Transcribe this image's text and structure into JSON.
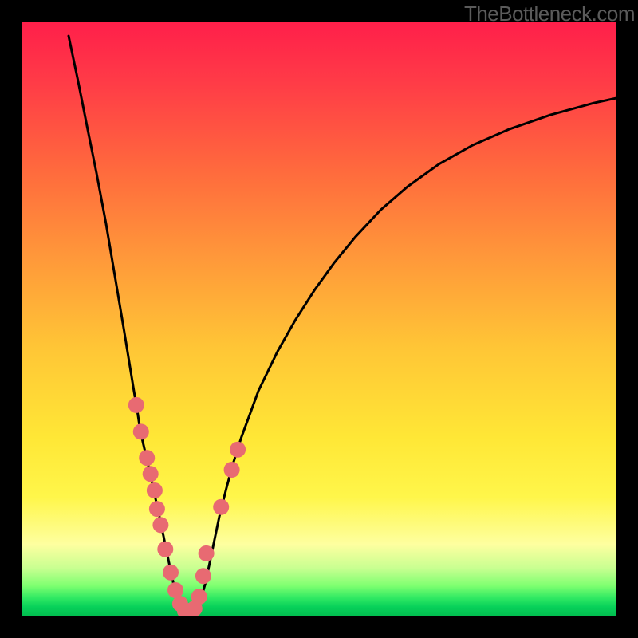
{
  "watermark": "TheBottleneck.com",
  "colors": {
    "curve": "#000000",
    "dots": "#e86a72",
    "frame": "#000000"
  },
  "chart_data": {
    "type": "line",
    "title": "",
    "xlabel": "",
    "ylabel": "",
    "xlim": [
      0,
      100
    ],
    "ylim": [
      0,
      100
    ],
    "note": "Axes are implicit (no ticks shown). x spans plot width, y spans plot height (0 at bottom, 100 at top). Values approximated from pixel positions on a 744x744 plot inside an 800x800 frame.",
    "series": [
      {
        "name": "left_branch",
        "x": [
          7.8,
          9.4,
          10.9,
          12.5,
          14.1,
          15.6,
          17.2,
          18.8,
          19.4,
          19.9,
          20.7,
          21.5,
          22.3,
          23.1,
          23.9,
          24.7,
          25.5,
          26.3,
          27.1
        ],
        "y": [
          97.7,
          90.1,
          82.5,
          74.6,
          66.1,
          57.2,
          47.7,
          37.9,
          34.4,
          31.0,
          27.6,
          24.1,
          20.4,
          16.7,
          12.9,
          9.0,
          5.3,
          2.5,
          1.0
        ]
      },
      {
        "name": "valley_floor",
        "x": [
          27.1,
          27.8,
          28.5,
          29.2
        ],
        "y": [
          1.0,
          0.6,
          0.6,
          1.0
        ]
      },
      {
        "name": "right_branch",
        "x": [
          29.2,
          30.0,
          30.8,
          31.6,
          32.4,
          33.2,
          34.4,
          35.6,
          36.9,
          39.8,
          43.0,
          46.0,
          49.2,
          52.5,
          56.1,
          60.4,
          64.9,
          70.2,
          75.9,
          82.1,
          89.0,
          96.3,
          100.0
        ],
        "y": [
          1.0,
          2.5,
          5.3,
          9.0,
          12.9,
          16.7,
          21.5,
          25.9,
          30.0,
          37.9,
          44.5,
          49.8,
          54.8,
          59.4,
          63.8,
          68.4,
          72.3,
          76.1,
          79.3,
          82.0,
          84.4,
          86.4,
          87.2
        ]
      }
    ],
    "markers": {
      "name": "pink_dots",
      "comment": "Salmon/pink marker points highlighted along the lower portion of the V-curve, radius ~10px",
      "x": [
        19.2,
        20.0,
        21.0,
        21.6,
        22.3,
        22.7,
        23.3,
        24.1,
        25.0,
        25.8,
        26.6,
        27.4,
        28.2,
        29.0,
        29.8,
        30.5,
        31.0,
        33.5,
        35.3,
        36.3
      ],
      "y": [
        35.5,
        31.0,
        26.6,
        23.9,
        21.1,
        18.0,
        15.3,
        11.2,
        7.3,
        4.3,
        2.0,
        0.8,
        0.8,
        1.2,
        3.2,
        6.7,
        10.5,
        18.3,
        24.6,
        28.0
      ]
    }
  }
}
